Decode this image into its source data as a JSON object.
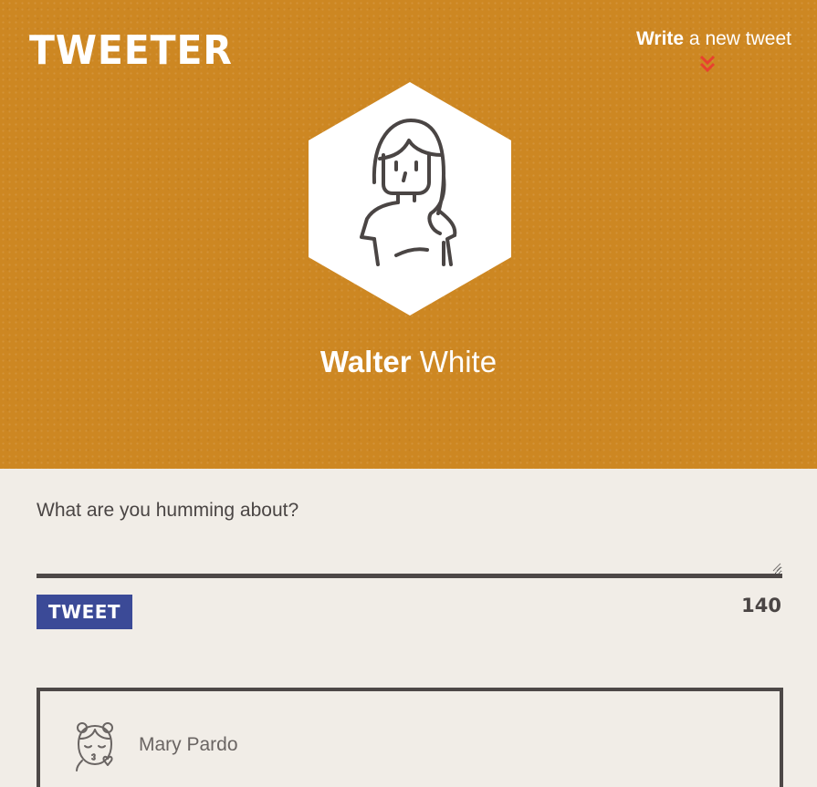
{
  "header": {
    "logo": "TWEETER",
    "write_link": {
      "strong": "Write",
      "rest": " a new tweet"
    },
    "accent_color": "#e8412f",
    "background_color": "#cd8722",
    "avatar_icon": "user-avatar-icon"
  },
  "user": {
    "first_name": "Walter",
    "last_name": "White"
  },
  "compose": {
    "label": "What are you humming about?",
    "value": "",
    "button_label": "TWEET",
    "button_color": "#3b4a97",
    "char_count": "140"
  },
  "tweets": [
    {
      "author": "Mary Pardo",
      "avatar_icon": "girl-avatar-icon"
    }
  ]
}
